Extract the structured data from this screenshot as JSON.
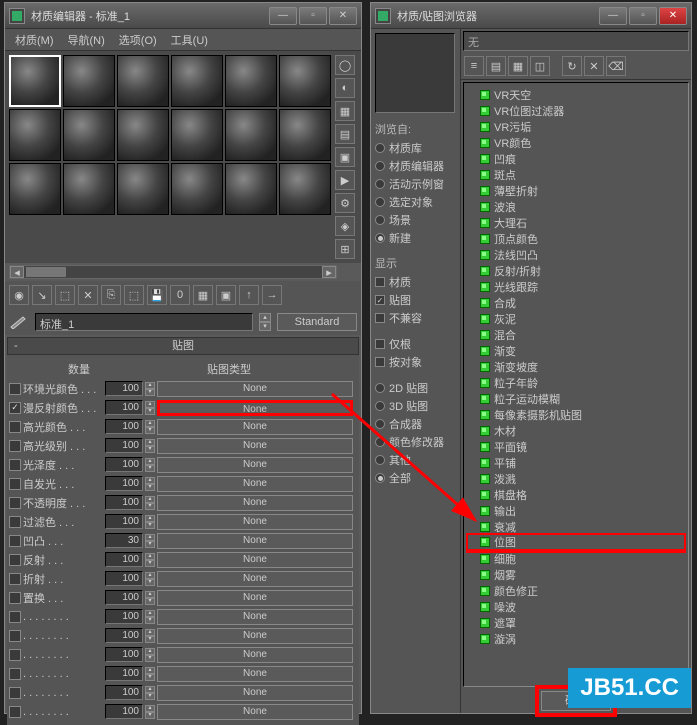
{
  "matEditor": {
    "title": "材质编辑器 - 标准_1",
    "menus": [
      "材质(M)",
      "导航(N)",
      "选项(O)",
      "工具(U)"
    ],
    "nameField": "标准_1",
    "typeButton": "Standard",
    "rolloutTitle": "贴图",
    "colHeaders": {
      "amount": "数量",
      "type": "贴图类型"
    },
    "rows": [
      {
        "on": false,
        "label": "环境光颜色",
        "amt": "100",
        "map": "None"
      },
      {
        "on": true,
        "label": "漫反射颜色",
        "amt": "100",
        "map": "None",
        "hl": true
      },
      {
        "on": false,
        "label": "高光颜色",
        "amt": "100",
        "map": "None"
      },
      {
        "on": false,
        "label": "高光级别",
        "amt": "100",
        "map": "None"
      },
      {
        "on": false,
        "label": "光泽度",
        "amt": "100",
        "map": "None"
      },
      {
        "on": false,
        "label": "自发光",
        "amt": "100",
        "map": "None"
      },
      {
        "on": false,
        "label": "不透明度",
        "amt": "100",
        "map": "None"
      },
      {
        "on": false,
        "label": "过滤色",
        "amt": "100",
        "map": "None"
      },
      {
        "on": false,
        "label": "凹凸",
        "amt": "30",
        "map": "None"
      },
      {
        "on": false,
        "label": "反射",
        "amt": "100",
        "map": "None"
      },
      {
        "on": false,
        "label": "折射",
        "amt": "100",
        "map": "None"
      },
      {
        "on": false,
        "label": "置换",
        "amt": "100",
        "map": "None"
      },
      {
        "on": false,
        "label": "",
        "amt": "100",
        "map": "None"
      },
      {
        "on": false,
        "label": "",
        "amt": "100",
        "map": "None"
      },
      {
        "on": false,
        "label": "",
        "amt": "100",
        "map": "None"
      },
      {
        "on": false,
        "label": "",
        "amt": "100",
        "map": "None"
      },
      {
        "on": false,
        "label": "",
        "amt": "100",
        "map": "None"
      },
      {
        "on": false,
        "label": "",
        "amt": "100",
        "map": "None"
      }
    ]
  },
  "browser": {
    "title": "材质/贴图浏览器",
    "search": "无",
    "browseFrom": {
      "label": "浏览自:",
      "items": [
        {
          "label": "材质库",
          "on": false
        },
        {
          "label": "材质编辑器",
          "on": false
        },
        {
          "label": "活动示例窗",
          "on": false
        },
        {
          "label": "选定对象",
          "on": false
        },
        {
          "label": "场景",
          "on": false
        },
        {
          "label": "新建",
          "on": true
        }
      ]
    },
    "show": {
      "label": "显示",
      "items": [
        {
          "label": "材质",
          "on": false
        },
        {
          "label": "贴图",
          "on": true
        },
        {
          "label": "不兼容",
          "on": false
        }
      ]
    },
    "show2": [
      {
        "label": "仅根",
        "on": false
      },
      {
        "label": "按对象",
        "on": false
      }
    ],
    "filter": [
      {
        "label": "2D 贴图",
        "on": false
      },
      {
        "label": "3D 贴图",
        "on": false
      },
      {
        "label": "合成器",
        "on": false
      },
      {
        "label": "颜色修改器",
        "on": false
      },
      {
        "label": "其他",
        "on": false
      },
      {
        "label": "全部",
        "on": true
      }
    ],
    "tree": [
      "VR天空",
      "VR位图过滤器",
      "VR污垢",
      "VR颜色",
      "凹痕",
      "斑点",
      "薄壁折射",
      "波浪",
      "大理石",
      "顶点颜色",
      "法线凹凸",
      "反射/折射",
      "光线跟踪",
      "合成",
      "灰泥",
      "混合",
      "渐变",
      "渐变坡度",
      "粒子年龄",
      "粒子运动模糊",
      "每像素摄影机贴图",
      "木材",
      "平面镜",
      "平铺",
      "泼溅",
      "棋盘格",
      "输出",
      "衰减",
      "位图",
      "细胞",
      "烟雾",
      "颜色修正",
      "噪波",
      "遮罩",
      "漩涡"
    ],
    "hlItem": "位图",
    "ok": "确定"
  },
  "watermark": "JB51.CC"
}
